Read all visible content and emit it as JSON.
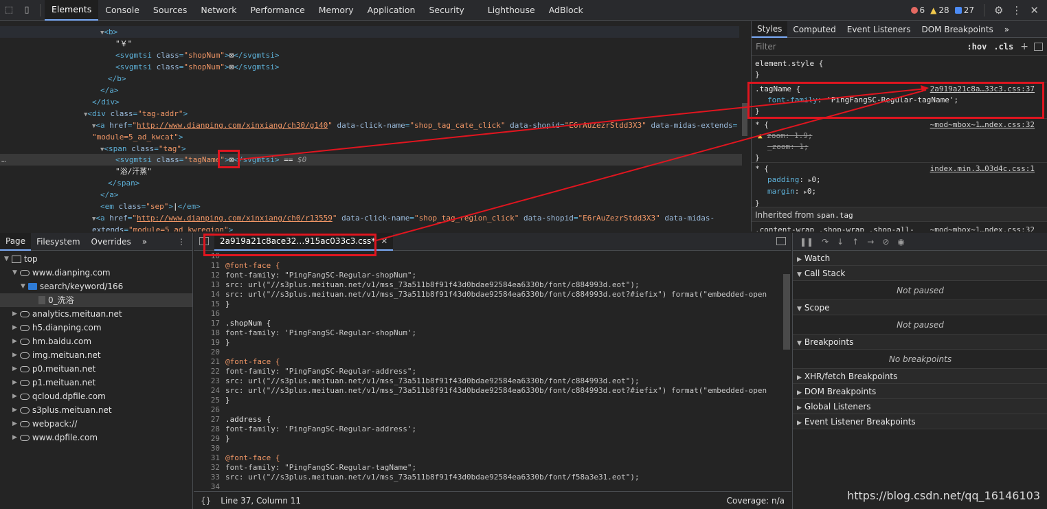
{
  "topbar": {
    "tabs": [
      "Elements",
      "Console",
      "Sources",
      "Network",
      "Performance",
      "Memory",
      "Application",
      "Security",
      "Lighthouse",
      "AdBlock"
    ],
    "active_tab": "Elements",
    "errors": "6",
    "warnings": "28",
    "infos": "27"
  },
  "elements": {
    "lines": [
      {
        "t": "▼<b>"
      },
      {
        "t": "\"￥\""
      },
      {
        "t": "<svgmtsi class=\"shopNum\">⊠</svgmtsi>"
      },
      {
        "t": "<svgmtsi class=\"shopNum\">⊠</svgmtsi>"
      },
      {
        "t": "</b>"
      },
      {
        "t": "</a>"
      },
      {
        "t": "</div>"
      },
      {
        "t": "▼<div class=\"tag-addr\">"
      },
      {
        "t": "▼<a href=\"http://www.dianping.com/xinxiang/ch30/g140\" data-click-name=\"shop_tag_cate_click\" data-shopid=\"E6rAuZezrStdd3X3\" data-midas-extends="
      },
      {
        "t": "\"module=5_ad_kwcat\">"
      },
      {
        "t": "▼<span class=\"tag\">"
      },
      {
        "t": "<svgmtsi class=\"tagName\">⊠</svgmtsi> == $0"
      },
      {
        "t": "\"浴/汗蒸\""
      },
      {
        "t": "</span>"
      },
      {
        "t": "</a>"
      },
      {
        "t": "<em class=\"sep\">|</em>"
      },
      {
        "t": "▼<a href=\"http://www.dianping.com/xinxiang/ch0/r13559\" data-click-name=\"shop_tag_region_click\" data-shopid=\"E6rAuZezrStdd3X3\" data-midas-"
      },
      {
        "t": "extends=\"module=5_ad_kwregion\">"
      }
    ]
  },
  "styles": {
    "tabs": [
      "Styles",
      "Computed",
      "Event Listeners",
      "DOM Breakpoints",
      "»"
    ],
    "filter_placeholder": "Filter",
    "hov": ":hov",
    "cls": ".cls",
    "element_style": "element.style {",
    "close_brace": "}",
    "rule1_selector": ".tagName {",
    "rule1_src": "2a919a21c8a…33c3.css:37",
    "rule1_prop": "font-family",
    "rule1_val": "'PingFangSC-Regular-tagName';",
    "rule2_selector": "* {",
    "rule2_src": "~mod~mbox~1…ndex.css:32",
    "rule2_p1": "zoom: 1.9;",
    "rule2_p2": "_zoom: 1;",
    "rule3_selector": "* {",
    "rule3_src": "index.min.3…03d4c.css:1",
    "rule3_p1": "padding",
    "rule3_v1": "0;",
    "rule3_p2": "margin",
    "rule3_v2": "0;",
    "inherited_label": "Inherited from",
    "inherited_el": "span.tag",
    "cut_line": ".content-wrap .shop-wrap .shop-all-",
    "cut_src": "~mod~mbox~1…ndex.css:32"
  },
  "navigator": {
    "tabs": [
      "Page",
      "Filesystem",
      "Overrides",
      "»"
    ],
    "items": [
      "top",
      "www.dianping.com",
      "search/keyword/166",
      "0_洗浴",
      "analytics.meituan.net",
      "h5.dianping.com",
      "hm.baidu.com",
      "img.meituan.net",
      "p0.meituan.net",
      "p1.meituan.net",
      "qcloud.dpfile.com",
      "s3plus.meituan.net",
      "webpack://",
      "www.dpfile.com"
    ]
  },
  "editor": {
    "tab_label": "2a919a21c8ace32…915ac033c3.css*",
    "lines": [
      {
        "n": "10",
        "c": ""
      },
      {
        "n": "11",
        "c": "@font-face {"
      },
      {
        "n": "12",
        "c": "    font-family: \"PingFangSC-Regular-shopNum\";"
      },
      {
        "n": "13",
        "c": "    src: url(\"//s3plus.meituan.net/v1/mss_73a511b8f91f43d0bdae92584ea6330b/font/c884993d.eot\");"
      },
      {
        "n": "14",
        "c": "    src: url(\"//s3plus.meituan.net/v1/mss_73a511b8f91f43d0bdae92584ea6330b/font/c884993d.eot?#iefix\") format(\"embedded-open"
      },
      {
        "n": "15",
        "c": "}"
      },
      {
        "n": "16",
        "c": ""
      },
      {
        "n": "17",
        "c": ".shopNum {"
      },
      {
        "n": "18",
        "c": "    font-family: 'PingFangSC-Regular-shopNum';"
      },
      {
        "n": "19",
        "c": "}"
      },
      {
        "n": "20",
        "c": ""
      },
      {
        "n": "21",
        "c": "@font-face {"
      },
      {
        "n": "22",
        "c": "    font-family: \"PingFangSC-Regular-address\";"
      },
      {
        "n": "23",
        "c": "    src: url(\"//s3plus.meituan.net/v1/mss_73a511b8f91f43d0bdae92584ea6330b/font/c884993d.eot\");"
      },
      {
        "n": "24",
        "c": "    src: url(\"//s3plus.meituan.net/v1/mss_73a511b8f91f43d0bdae92584ea6330b/font/c884993d.eot?#iefix\") format(\"embedded-open"
      },
      {
        "n": "25",
        "c": "}"
      },
      {
        "n": "26",
        "c": ""
      },
      {
        "n": "27",
        "c": ".address {"
      },
      {
        "n": "28",
        "c": "    font-family: 'PingFangSC-Regular-address';"
      },
      {
        "n": "29",
        "c": "}"
      },
      {
        "n": "30",
        "c": ""
      },
      {
        "n": "31",
        "c": "@font-face {"
      },
      {
        "n": "32",
        "c": "    font-family: \"PingFangSC-Regular-tagName\";"
      },
      {
        "n": "33",
        "c": "    src: url(\"//s3plus.meituan.net/v1/mss_73a511b8f91f43d0bdae92584ea6330b/font/f58a3e31.eot\");"
      },
      {
        "n": "34",
        "c": ""
      }
    ],
    "status_position": "Line 37, Column 11",
    "coverage": "Coverage: n/a",
    "curly_icon": "{}"
  },
  "debugger": {
    "sections": [
      "Watch",
      "Call Stack",
      "Scope",
      "Breakpoints",
      "XHR/fetch Breakpoints",
      "DOM Breakpoints",
      "Global Listeners",
      "Event Listener Breakpoints"
    ],
    "not_paused": "Not paused",
    "no_breakpoints": "No breakpoints"
  },
  "watermark": "https://blog.csdn.net/qq_16146103",
  "colors": {
    "annotation_red": "#e0151f",
    "accent": "#7cacf8"
  }
}
